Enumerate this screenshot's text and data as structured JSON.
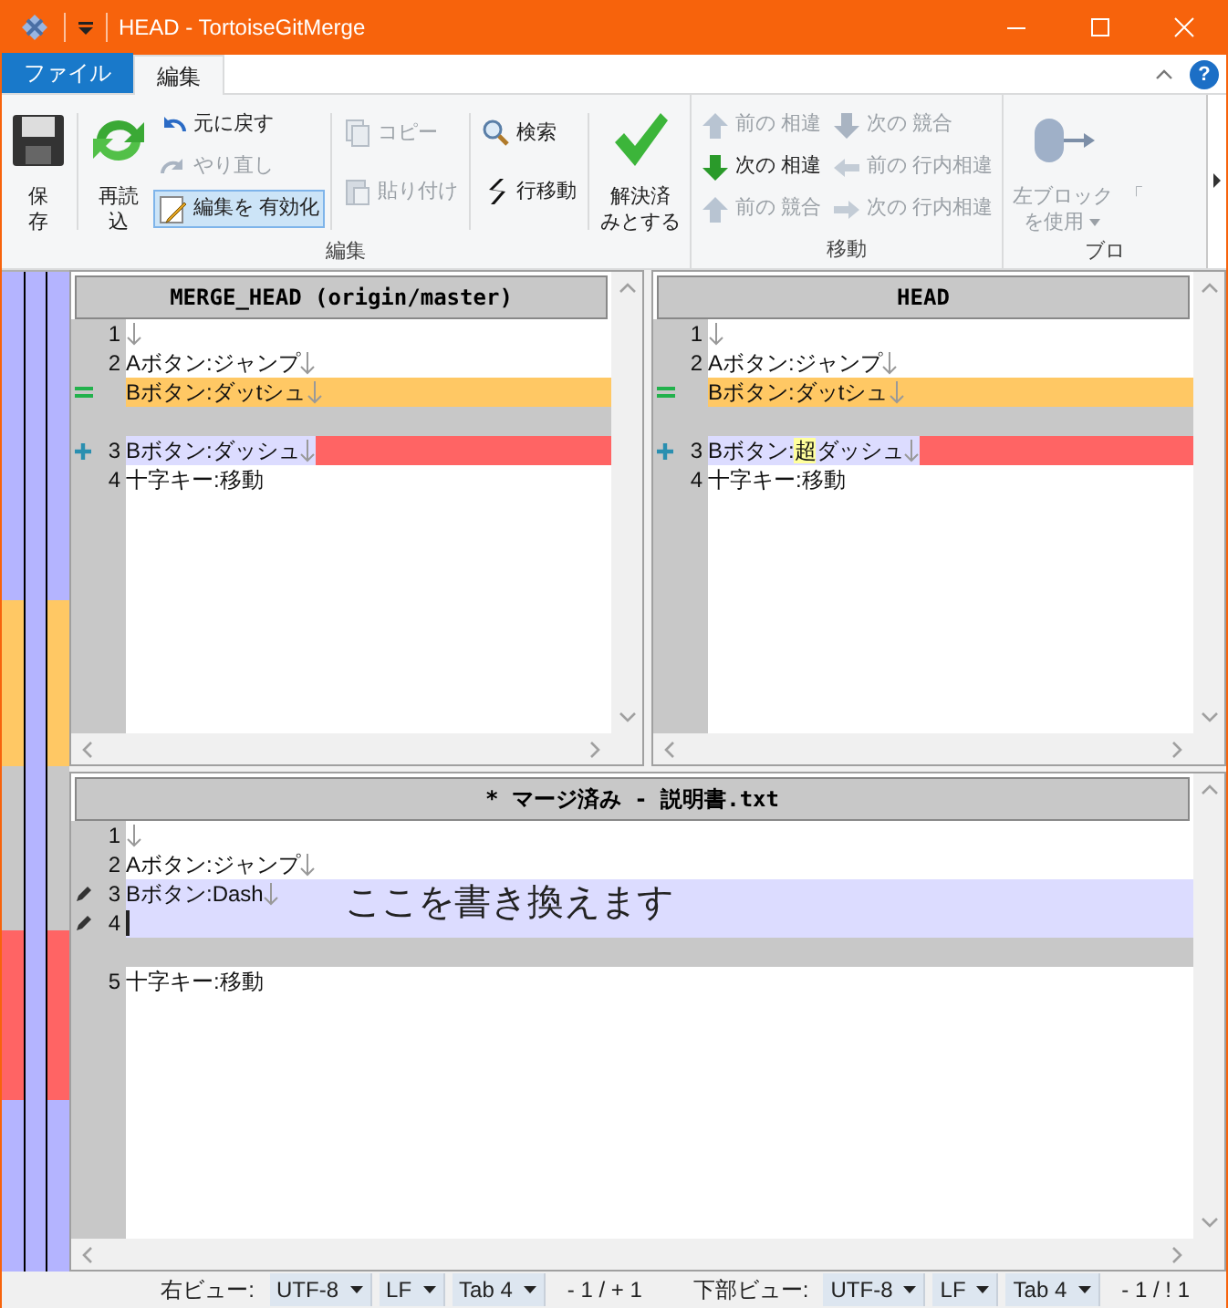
{
  "window": {
    "title": "HEAD - TortoiseGitMerge"
  },
  "help_button": "?",
  "ribbon_tabs": [
    {
      "label": "ファイル",
      "kind": "file",
      "selected": false
    },
    {
      "label": "編集",
      "kind": "tab",
      "selected": true
    }
  ],
  "ribbon_groups": [
    {
      "label": "編集",
      "sections": [
        {
          "columns": [
            [
              {
                "kind": "large",
                "lines": [
                  "保",
                  "存"
                ],
                "disabled": false,
                "pressed": false
              }
            ]
          ]
        },
        {
          "columns": [
            [
              {
                "kind": "large",
                "lines": [
                  "再読",
                  "込"
                ],
                "disabled": false,
                "pressed": false
              }
            ],
            [
              {
                "kind": "small",
                "lines": [
                  "元に戻す"
                ],
                "disabled": false,
                "pressed": false
              },
              {
                "kind": "small",
                "lines": [
                  "やり直し"
                ],
                "disabled": true,
                "pressed": false
              },
              {
                "kind": "small",
                "lines": [
                  "編集を 有効化"
                ],
                "disabled": false,
                "pressed": true
              }
            ]
          ]
        },
        {
          "columns": [
            [
              {
                "kind": "small",
                "lines": [
                  "コピー"
                ],
                "disabled": true,
                "pressed": false
              },
              {
                "kind": "small",
                "lines": [
                  "貼り付け"
                ],
                "disabled": true,
                "pressed": false
              }
            ]
          ]
        },
        {
          "columns": [
            [
              {
                "kind": "small",
                "lines": [
                  "検索"
                ],
                "disabled": false,
                "pressed": false
              },
              {
                "kind": "small",
                "lines": [
                  "行移動"
                ],
                "disabled": false,
                "pressed": false
              }
            ]
          ]
        },
        {
          "columns": [
            [
              {
                "kind": "large",
                "lines": [
                  "解決済",
                  "みとする"
                ],
                "disabled": false,
                "pressed": false
              }
            ]
          ]
        }
      ]
    },
    {
      "label": "移動",
      "sections": [
        {
          "columns": [
            [
              {
                "kind": "small",
                "lines": [
                  "前の 相違"
                ],
                "disabled": true,
                "pressed": false
              },
              {
                "kind": "small",
                "lines": [
                  "次の 相違"
                ],
                "disabled": false,
                "pressed": false
              },
              {
                "kind": "small",
                "lines": [
                  "前の 競合"
                ],
                "disabled": true,
                "pressed": false
              }
            ],
            [
              {
                "kind": "small",
                "lines": [
                  "次の 競合"
                ],
                "disabled": true,
                "pressed": false
              },
              {
                "kind": "small",
                "lines": [
                  "前の 行内相違"
                ],
                "disabled": true,
                "pressed": false
              },
              {
                "kind": "small",
                "lines": [
                  "次の 行内相違"
                ],
                "disabled": true,
                "pressed": false
              }
            ]
          ]
        }
      ]
    },
    {
      "label": "ブロ",
      "sections": [
        {
          "columns": [
            [
              {
                "kind": "large-dropdown",
                "lines": [
                  "左ブロック",
                  "を使用"
                ],
                "disabled": true,
                "pressed": false
              }
            ],
            [
              {
                "kind": "large",
                "lines": [
                  "「"
                ],
                "disabled": true,
                "pressed": false
              }
            ]
          ]
        }
      ]
    }
  ],
  "panes": [
    {
      "title": "MERGE_HEAD (origin/master)",
      "lines": [
        {
          "number": "1",
          "kind": "normal",
          "eol": true
        },
        {
          "number": "2",
          "text": "Aボタン:ジャンプ",
          "kind": "normal",
          "eol": true
        },
        {
          "text": "Bボタン:ダッtシュ",
          "kind": "equal",
          "eol": true
        },
        {
          "kind": "blank",
          "eol": false
        },
        {
          "number": "3",
          "text": "Bボタン:ダッシュ",
          "kind": "added",
          "eol": true
        },
        {
          "number": "4",
          "text": "十字キー:移動",
          "kind": "normal",
          "eol": false
        }
      ]
    },
    {
      "title": "HEAD",
      "lines": [
        {
          "number": "1",
          "kind": "normal",
          "eol": true
        },
        {
          "number": "2",
          "text": "Aボタン:ジャンプ",
          "kind": "normal",
          "eol": true
        },
        {
          "text": "Bボタン:ダッtシュ",
          "kind": "equal",
          "eol": true
        },
        {
          "kind": "blank",
          "eol": false
        },
        {
          "number": "3",
          "segments": [
            {
              "text": "Bボタン:",
              "highlight": false
            },
            {
              "text": "超",
              "highlight": true
            },
            {
              "text": "ダッシュ",
              "highlight": false
            }
          ],
          "kind": "added",
          "eol": true
        },
        {
          "number": "4",
          "text": "十字キー:移動",
          "kind": "normal",
          "eol": false
        }
      ]
    },
    {
      "title": "* マージ済み - 説明書.txt",
      "note": "ここを書き換えます",
      "lines": [
        {
          "number": "1",
          "kind": "normal",
          "eol": true
        },
        {
          "number": "2",
          "text": "Aボタン:ジャンプ",
          "kind": "normal",
          "eol": true
        },
        {
          "number": "3",
          "text": "Bボタン:Dash",
          "kind": "edited",
          "eol": true
        },
        {
          "number": "4",
          "kind": "edited",
          "eol": false,
          "cursor": true
        },
        {
          "kind": "blank",
          "eol": false
        },
        {
          "number": "5",
          "text": "十字キー:移動",
          "kind": "normal",
          "eol": false
        }
      ]
    }
  ],
  "status_bar": [
    {
      "kind": "label",
      "text": "右ビュー:"
    },
    {
      "kind": "dropdown",
      "text": "UTF-8"
    },
    {
      "kind": "dropdown",
      "text": "LF"
    },
    {
      "kind": "dropdown",
      "text": "Tab 4"
    },
    {
      "kind": "text",
      "text": "- 1 / + 1"
    },
    {
      "kind": "label",
      "text": "下部ビュー:"
    },
    {
      "kind": "dropdown",
      "text": "UTF-8"
    },
    {
      "kind": "dropdown",
      "text": "LF"
    },
    {
      "kind": "dropdown",
      "text": "Tab 4"
    },
    {
      "kind": "text",
      "text": "- 1 / ! 1"
    }
  ]
}
